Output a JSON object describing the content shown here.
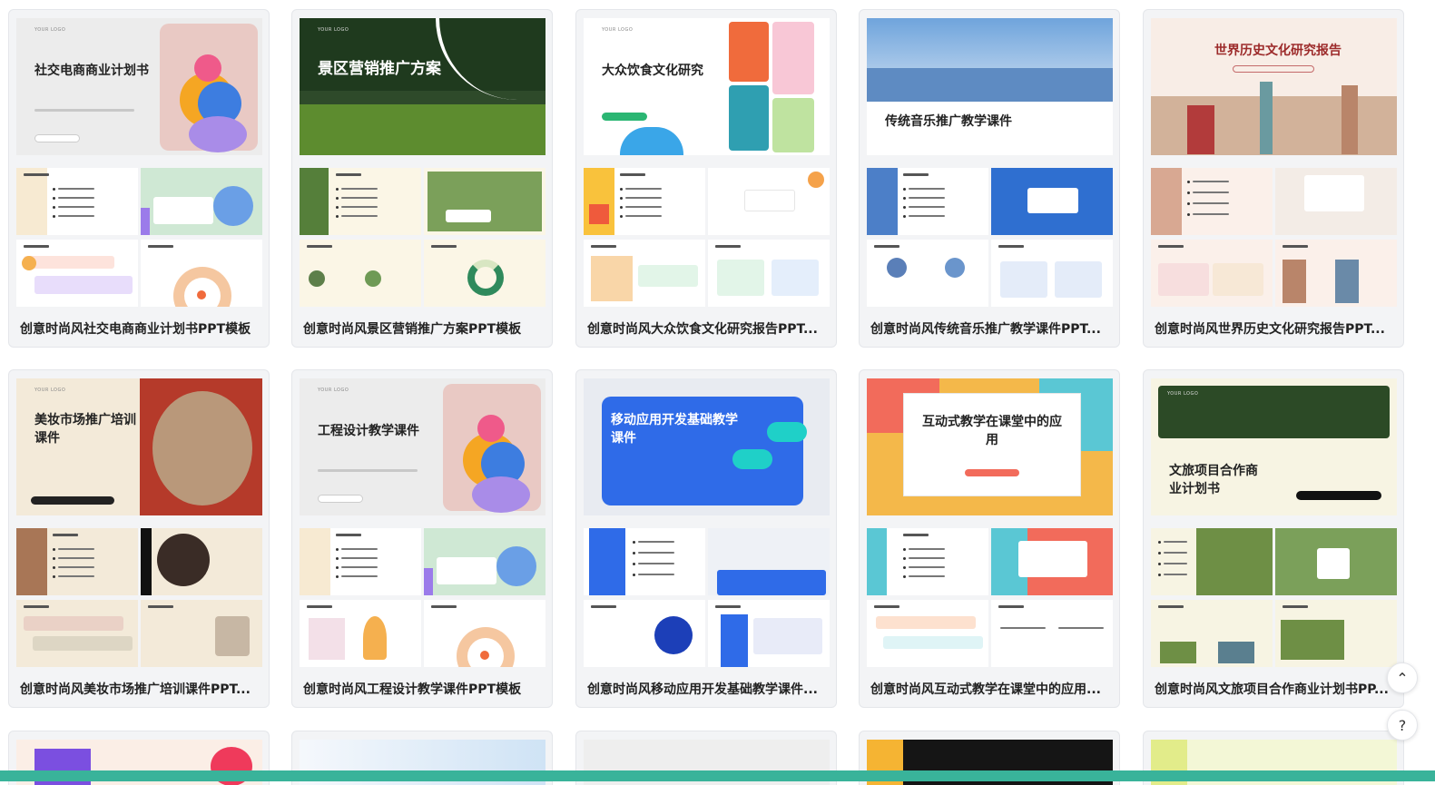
{
  "cards": [
    {
      "caption": "创意时尚风社交电商商业计划书PPT模板",
      "hero_title": "社交电商商业计划书"
    },
    {
      "caption": "创意时尚风景区营销推广方案PPT模板",
      "hero_title": "景区营销推广方案"
    },
    {
      "caption": "创意时尚风大众饮食文化研究报告PPT...",
      "hero_title": "大众饮食文化研究"
    },
    {
      "caption": "创意时尚风传统音乐推广教学课件PPT...",
      "hero_title": "传统音乐推广教学课件"
    },
    {
      "caption": "创意时尚风世界历史文化研究报告PPT...",
      "hero_title": "世界历史文化研究报告"
    },
    {
      "caption": "创意时尚风美妆市场推广培训课件PPT...",
      "hero_title": "美妆市场推广培训课件"
    },
    {
      "caption": "创意时尚风工程设计教学课件PPT模板",
      "hero_title": "工程设计教学课件"
    },
    {
      "caption": "创意时尚风移动应用开发基础教学课件...",
      "hero_title": "移动应用开发基础教学课件"
    },
    {
      "caption": "创意时尚风互动式教学在课堂中的应用...",
      "hero_title": "互动式教学在课堂中的应用"
    },
    {
      "caption": "创意时尚风文旅项目合作商业计划书PP...",
      "hero_title": "文旅项目合作商业计划书"
    }
  ],
  "icons": {
    "scroll_top": "chevron-up-icon",
    "help": "question-icon"
  },
  "glyphs": {
    "scroll_top": "⌃",
    "help": "?"
  },
  "colors": {
    "accent": "#39b39a",
    "card_bg": "#f3f4f6",
    "border": "#e4e6ea"
  }
}
